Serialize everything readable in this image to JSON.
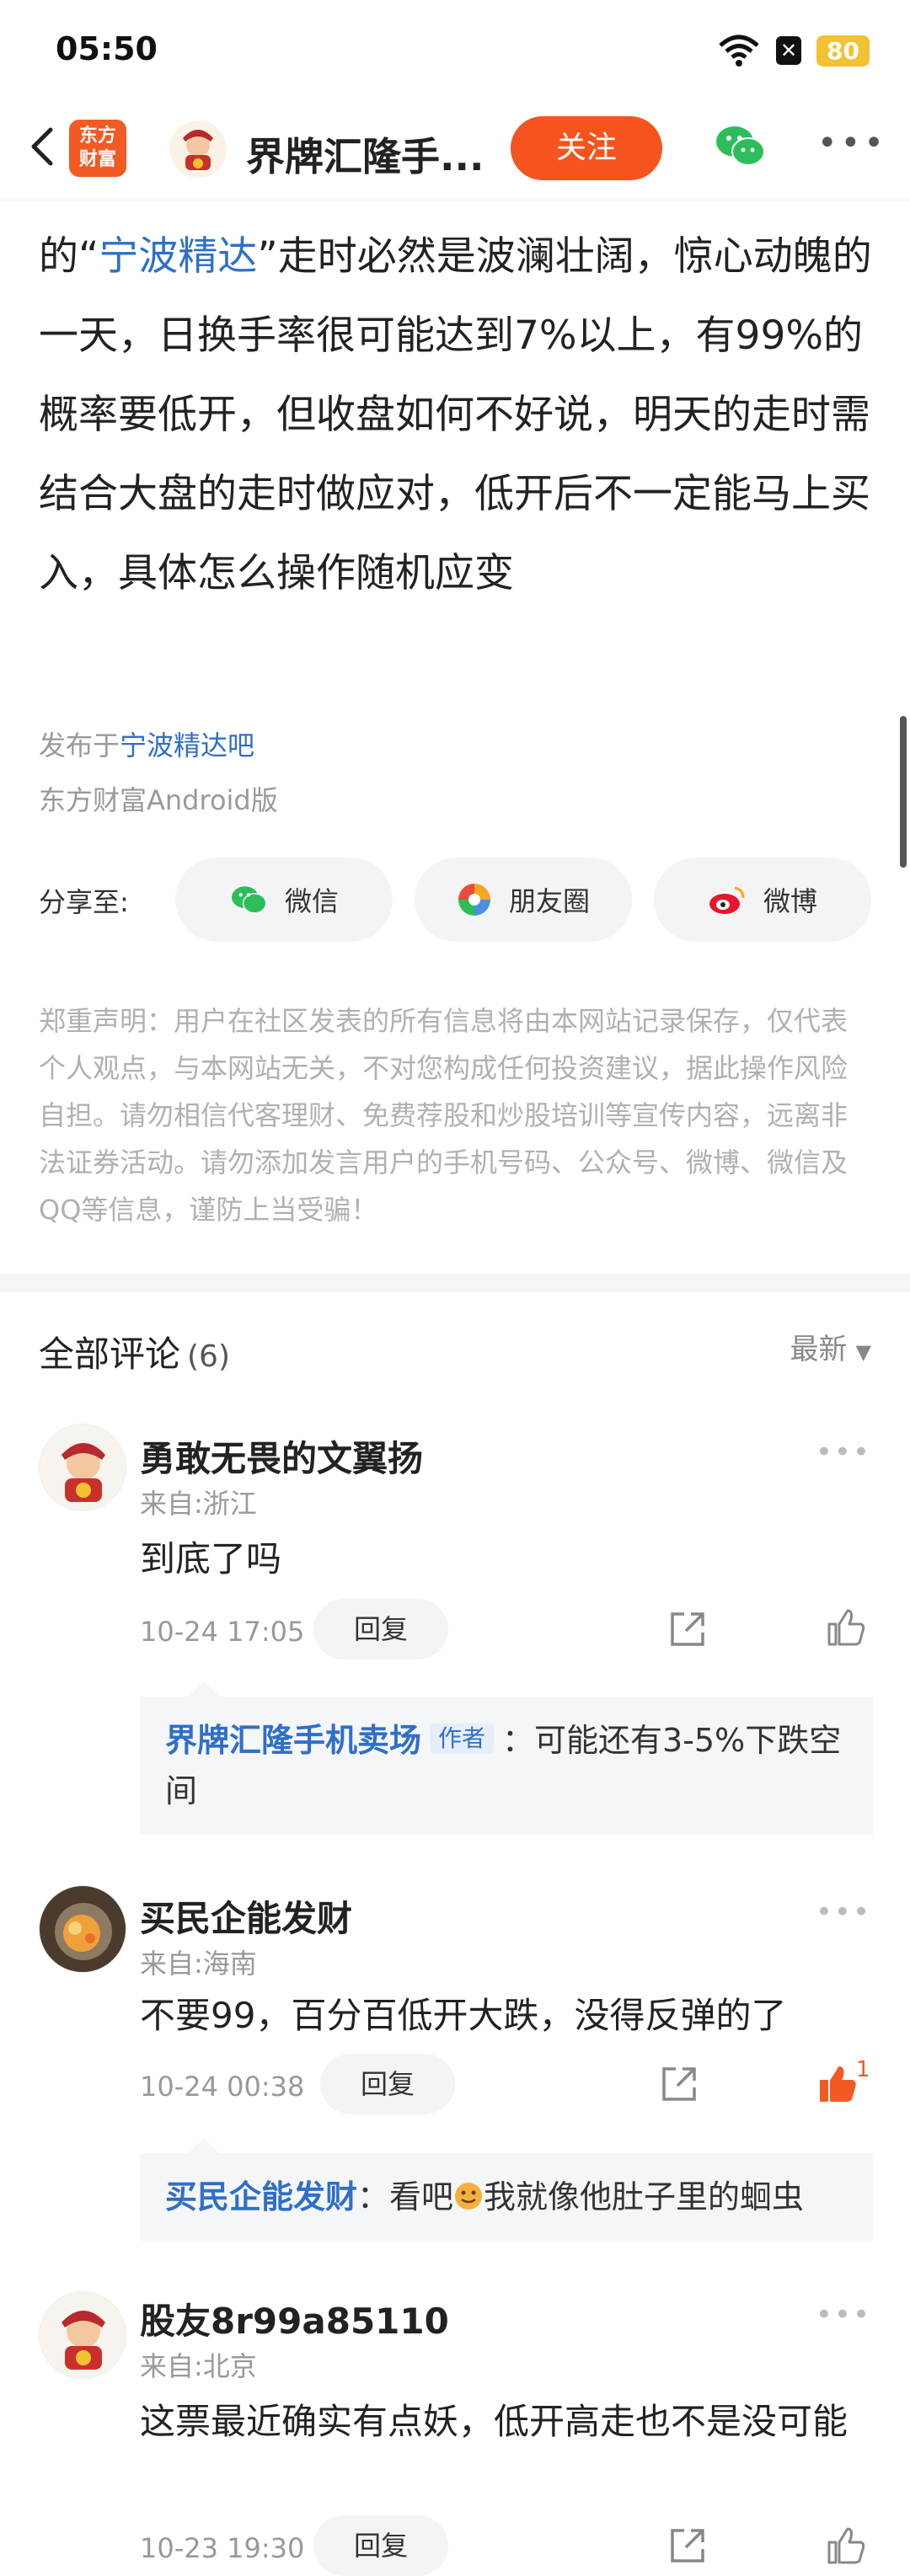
{
  "status": {
    "time": "05:50",
    "battery": "80"
  },
  "nav": {
    "logo_line1": "东方",
    "logo_line2": "财富",
    "title": "界牌汇隆手...",
    "follow_label": "关注"
  },
  "article": {
    "seg1": "的“",
    "link": "宁波精达",
    "seg2": "”走时必然是波澜壮阔，惊心动魄的一天，日换手率很可能达到7%以上，有99%的概率要低开，但收盘如何不好说，明天的走时需结合大盘的走时做应对，低开后不一定能马上买入，具体怎么操作随机应变",
    "published_prefix": "发布于",
    "published_bar": "宁波精达吧",
    "client": "东方财富Android版"
  },
  "share": {
    "label": "分享至:",
    "wechat": "微信",
    "moments": "朋友圈",
    "weibo": "微博"
  },
  "disclaimer": "郑重声明：用户在社区发表的所有信息将由本网站记录保存，仅代表个人观点，与本网站无关，不对您构成任何投资建议，据此操作风险自担。请勿相信代客理财、免费荐股和炒股培训等宣传内容，远离非法证券活动。请勿添加发言用户的手机号码、公众号、微博、微信及QQ等信息，谨防上当受骗！",
  "comments": {
    "title": "全部评论",
    "count": "(6)",
    "sort": "最新",
    "items": [
      {
        "name": "勇敢无畏的文翼扬",
        "location": "来自:浙江",
        "text": "到底了吗",
        "time": "10-24 17:05",
        "reply_label": "回复",
        "reply": {
          "name": "界牌汇隆手机卖场",
          "tag": "作者",
          "text": "：可能还有3-5%下跌空间"
        }
      },
      {
        "name": "买民企能发财",
        "location": "来自:海南",
        "text": "不要99，百分百低开大跌，没得反弹的了",
        "time": "10-24 00:38",
        "reply_label": "回复",
        "likes": "1",
        "reply": {
          "name": "买民企能发财",
          "text1": "：看吧",
          "text2": "我就像他肚子里的蛔虫"
        }
      },
      {
        "name": "股友8r99a85110",
        "location": "来自:北京",
        "text": "这票最近确实有点妖，低开高走也不是没可能",
        "time": "10-23 19:30",
        "reply_label": "回复"
      }
    ]
  },
  "colors": {
    "accent": "#f5541e",
    "link": "#2f6fc8"
  }
}
